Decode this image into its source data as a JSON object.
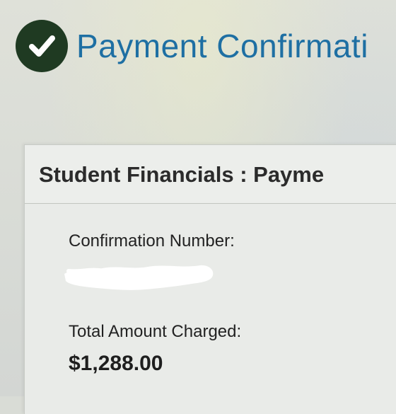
{
  "header": {
    "title": "Payment Confirmati",
    "icon": "check-circle-icon",
    "icon_color": "#1f3a22",
    "title_color": "#1e6fa3"
  },
  "panel": {
    "title": "Student Financials : Payme",
    "confirmation_label": "Confirmation Number:",
    "confirmation_value_redacted": true,
    "amount_label": "Total Amount Charged:",
    "amount_value": "$1,288.00"
  }
}
